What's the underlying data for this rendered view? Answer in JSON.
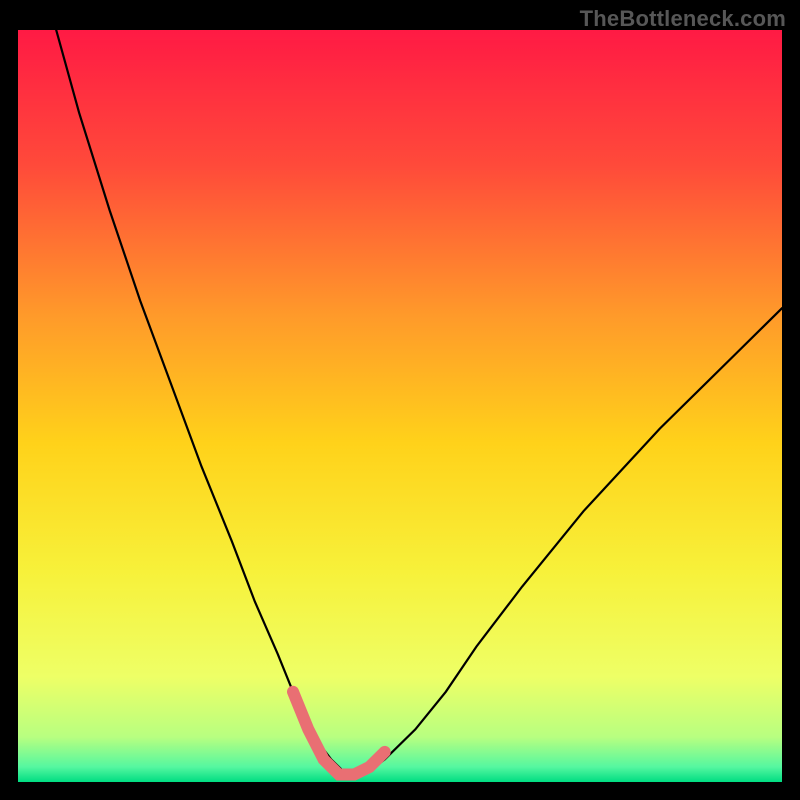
{
  "watermark": "TheBottleneck.com",
  "colors": {
    "frame": "#000000",
    "curve": "#000000",
    "highlight": "#e96f73",
    "gradient": [
      {
        "offset": "0%",
        "color": "#ff1a44"
      },
      {
        "offset": "18%",
        "color": "#ff4a3a"
      },
      {
        "offset": "38%",
        "color": "#ff9a2a"
      },
      {
        "offset": "55%",
        "color": "#ffd21a"
      },
      {
        "offset": "72%",
        "color": "#f7f13a"
      },
      {
        "offset": "86%",
        "color": "#eeff66"
      },
      {
        "offset": "94%",
        "color": "#b8ff80"
      },
      {
        "offset": "98%",
        "color": "#55f7a0"
      },
      {
        "offset": "100%",
        "color": "#00dd82"
      }
    ]
  },
  "chart_data": {
    "type": "line",
    "title": "",
    "xlabel": "",
    "ylabel": "",
    "xlim": [
      0,
      100
    ],
    "ylim": [
      0,
      100
    ],
    "note": "Bottleneck-percentage style curve. y axis plotted inverted so global minimum (y≈0) appears at the bottom. Values estimated from pixels.",
    "series": [
      {
        "name": "curve",
        "x": [
          5,
          8,
          12,
          16,
          20,
          24,
          28,
          31,
          34,
          36,
          38,
          39.5,
          41,
          42.5,
          44,
          46,
          48,
          52,
          56,
          60,
          66,
          74,
          84,
          94,
          100
        ],
        "y": [
          100,
          89,
          76,
          64,
          53,
          42,
          32,
          24,
          17,
          12,
          8,
          5,
          3,
          1.5,
          1,
          1.5,
          3,
          7,
          12,
          18,
          26,
          36,
          47,
          57,
          63
        ]
      },
      {
        "name": "highlight-min",
        "x": [
          36,
          38,
          40,
          42,
          44,
          46,
          48
        ],
        "y": [
          12,
          7,
          3,
          1,
          1,
          2,
          4
        ]
      }
    ]
  }
}
